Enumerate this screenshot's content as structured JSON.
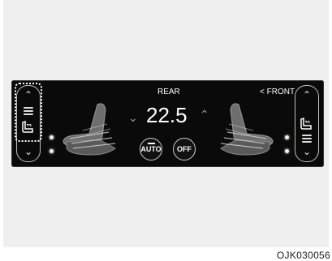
{
  "header": {
    "rear_label": "REAR",
    "front_label": "< FRONT"
  },
  "temperature": {
    "value": "22.5",
    "down_icon": "chevron-down-icon",
    "up_icon": "chevron-up-icon"
  },
  "buttons": {
    "auto_label": "AUTO",
    "off_label": "OFF"
  },
  "left_control": {
    "up_icon": "chevron-up-icon",
    "down_icon": "chevron-down-icon",
    "seat_icon": "seat-icon",
    "level_icon": "level-bars-icon",
    "highlighted": true
  },
  "right_control": {
    "up_icon": "chevron-up-icon",
    "down_icon": "chevron-down-icon",
    "seat_icon": "seat-icon",
    "level_icon": "level-bars-icon"
  },
  "caption": "OJK030056",
  "colors": {
    "panel": "#0a0a0a",
    "text": "#ffffff",
    "led": "#f7f2d6"
  }
}
